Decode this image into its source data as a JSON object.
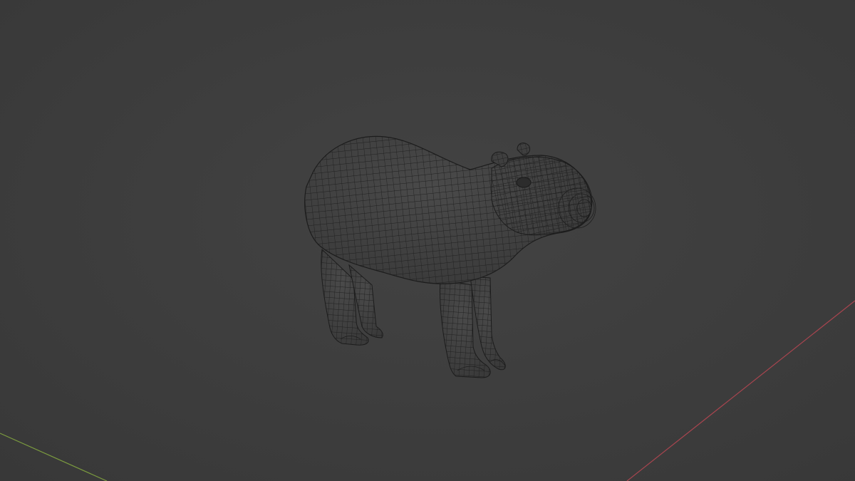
{
  "viewport": {
    "background_color": "#3d3d3d",
    "object": "capybara-wireframe-mesh",
    "display_mode": "wireframe",
    "x_axis_color": "#a8454f",
    "y_axis_color": "#7b9b3f",
    "wire_color": "#1e1e1e",
    "mesh_fill_color": "#414141"
  }
}
